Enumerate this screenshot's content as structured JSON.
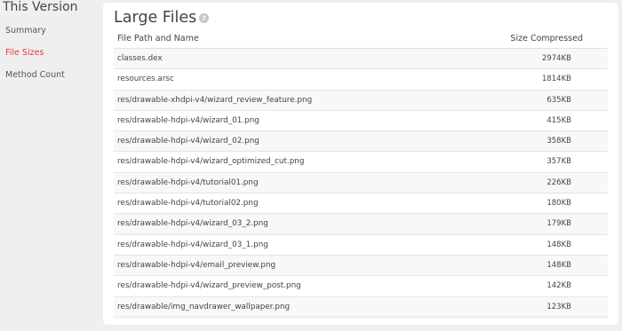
{
  "sidebar": {
    "title": "This Version",
    "items": [
      {
        "label": "Summary"
      },
      {
        "label": "File Sizes"
      },
      {
        "label": "Method Count"
      }
    ],
    "active_color": "#e53935"
  },
  "main": {
    "title": "Large Files",
    "help_icon": "help-circle-icon",
    "columns": [
      "File Path and Name",
      "Size Compressed"
    ],
    "rows": [
      {
        "path": "classes.dex",
        "size": "2974KB"
      },
      {
        "path": "resources.arsc",
        "size": "1814KB"
      },
      {
        "path": "res/drawable-xhdpi-v4/wizard_review_feature.png",
        "size": "635KB"
      },
      {
        "path": "res/drawable-hdpi-v4/wizard_01.png",
        "size": "415KB"
      },
      {
        "path": "res/drawable-hdpi-v4/wizard_02.png",
        "size": "358KB"
      },
      {
        "path": "res/drawable-hdpi-v4/wizard_optimized_cut.png",
        "size": "357KB"
      },
      {
        "path": "res/drawable-hdpi-v4/tutorial01.png",
        "size": "226KB"
      },
      {
        "path": "res/drawable-hdpi-v4/tutorial02.png",
        "size": "180KB"
      },
      {
        "path": "res/drawable-hdpi-v4/wizard_03_2.png",
        "size": "179KB"
      },
      {
        "path": "res/drawable-hdpi-v4/wizard_03_1.png",
        "size": "148KB"
      },
      {
        "path": "res/drawable-hdpi-v4/email_preview.png",
        "size": "148KB"
      },
      {
        "path": "res/drawable-hdpi-v4/wizard_preview_post.png",
        "size": "142KB"
      },
      {
        "path": "res/drawable/img_navdrawer_wallpaper.png",
        "size": "123KB"
      }
    ]
  }
}
